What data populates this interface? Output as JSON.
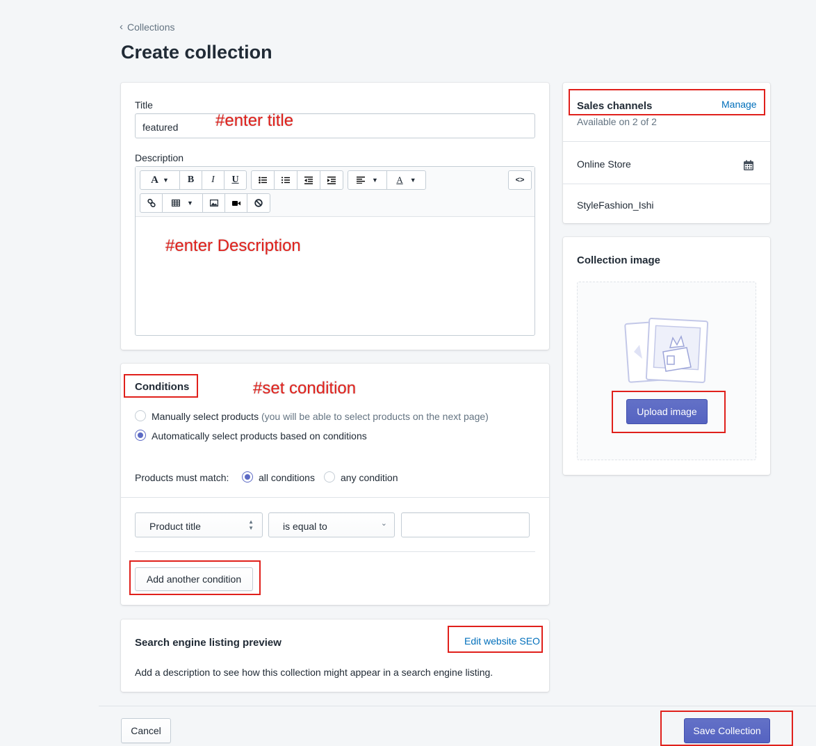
{
  "breadcrumb": {
    "label": "Collections"
  },
  "page": {
    "title": "Create collection"
  },
  "annotations": {
    "title": "#enter title",
    "description": "#enter Description",
    "condition": "#set condition"
  },
  "form": {
    "title_label": "Title",
    "title_value": "featured",
    "description_label": "Description"
  },
  "toolbar": {
    "font_a": "A",
    "bold": "B",
    "italic": "I",
    "underline": "U",
    "code": "<>",
    "text_color": "A"
  },
  "conditions": {
    "heading": "Conditions",
    "manual_label": "Manually select products",
    "manual_hint": "(you will be able to select products on the next page)",
    "auto_label": "Automatically select products based on conditions",
    "match_label": "Products must match:",
    "all_label": "all conditions",
    "any_label": "any condition",
    "field_value": "Product title",
    "operator_value": "is equal to",
    "value_input": "",
    "add_button": "Add another condition"
  },
  "seo": {
    "heading": "Search engine listing preview",
    "edit_link": "Edit website SEO",
    "description": "Add a description to see how this collection might appear in a search engine listing."
  },
  "sales_channels": {
    "heading": "Sales channels",
    "manage_link": "Manage",
    "availability": "Available on 2 of 2",
    "channels": [
      "Online Store",
      "StyleFashion_Ishi"
    ]
  },
  "collection_image": {
    "heading": "Collection image",
    "upload_button": "Upload image"
  },
  "footer": {
    "cancel": "Cancel",
    "save": "Save Collection"
  },
  "colors": {
    "primary": "#5c6ac4",
    "link": "#006fbb",
    "annotation": "#e0201b",
    "background": "#f4f6f8"
  }
}
